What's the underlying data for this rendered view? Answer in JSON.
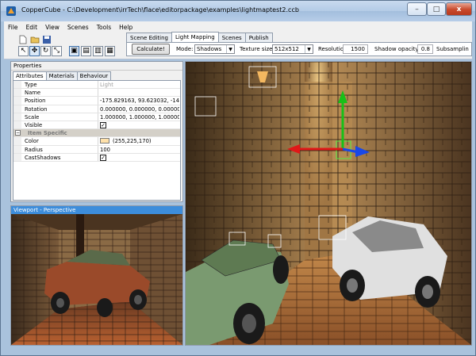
{
  "window": {
    "title": "CopperCube - C:\\Development\\irrTech\\flace\\editorpackage\\examples\\lightmaptest2.ccb",
    "minimize": "–",
    "maximize": "□",
    "close": "x"
  },
  "menu": [
    "File",
    "Edit",
    "View",
    "Scenes",
    "Tools",
    "Help"
  ],
  "tabs": [
    "Scene Editing",
    "Light Mapping",
    "Scenes",
    "Publish"
  ],
  "lightmap": {
    "calculate_label": "Calculate!",
    "mode_label": "Mode:",
    "mode_value": "Shadows",
    "texture_label": "Texture size:",
    "texture_value": "512x512",
    "resolution_label": "Resolution:",
    "resolution_value": "1500",
    "shadow_label": "Shadow opacity:",
    "shadow_value": "0.8",
    "subsampling_label": "Subsamplin"
  },
  "properties": {
    "title": "Properties",
    "tabs": [
      "Attributes",
      "Materials",
      "Behaviour"
    ],
    "rows": [
      {
        "name": "Type",
        "value": "Light"
      },
      {
        "name": "Name",
        "value": ""
      },
      {
        "name": "Position",
        "value": "-175.829163, 93.623032, -146."
      },
      {
        "name": "Rotation",
        "value": "0.000000, 0.000000, 0.000000"
      },
      {
        "name": "Scale",
        "value": "1.000000, 1.000000, 1.000000"
      },
      {
        "name": "Visible",
        "value": "✓"
      },
      {
        "name": "Item Specific",
        "value": ""
      },
      {
        "name": "Color",
        "value": "(255,225,170)"
      },
      {
        "name": "Radius",
        "value": "100"
      },
      {
        "name": "CastShadows",
        "value": "✓"
      }
    ],
    "category_toggle": "−"
  },
  "viewport_small": {
    "title": "Viewport - Perspective"
  },
  "colors": {
    "light_color": "#ffe1aa",
    "selection_blue": "#3d8ddb",
    "axis_x": "#e01818",
    "axis_y": "#18c018",
    "axis_z": "#1848e8"
  },
  "icons": [
    "app-logo-icon",
    "new-file-icon",
    "open-folder-icon",
    "save-icon",
    "select-arrow-icon",
    "move-icon",
    "rotate-icon",
    "scale-icon",
    "view-icon-1",
    "view-icon-2",
    "view-icon-3",
    "view-icon-4"
  ]
}
